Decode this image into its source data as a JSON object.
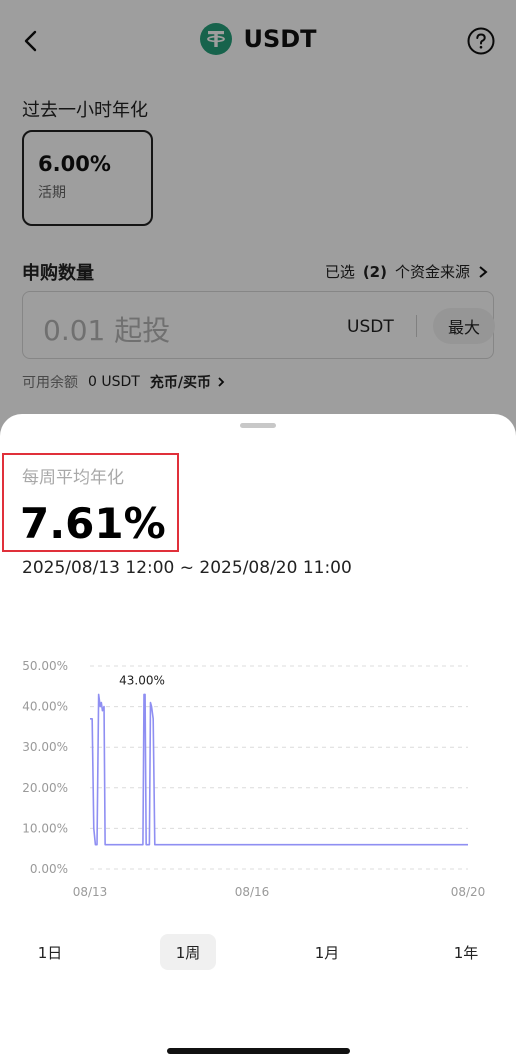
{
  "header": {
    "title": "USDT",
    "coin_icon": "tether-icon",
    "back_icon": "chevron-left-icon",
    "help_icon": "question-circle-icon"
  },
  "apr": {
    "label": "过去一小时年化",
    "value": "6.00%",
    "type": "活期"
  },
  "subscribe": {
    "label": "申购数量",
    "sources_prefix": "已选",
    "sources_count": "(2)",
    "sources_suffix": "个资金来源",
    "placeholder": "0.01 起投",
    "unit": "USDT",
    "max_label": "最大"
  },
  "balance": {
    "label": "可用余额",
    "amount": "0 USDT",
    "buy_label": "充币/买币"
  },
  "sheet": {
    "weekly_label": "每周平均年化",
    "weekly_value": "7.61%",
    "date_range": "2025/08/13 12:00 ~ 2025/08/20 11:00"
  },
  "chart_data": {
    "type": "line",
    "title": "",
    "xlabel": "",
    "ylabel": "",
    "ylim": [
      0,
      50
    ],
    "yticks": [
      "50.00%",
      "40.00%",
      "30.00%",
      "20.00%",
      "10.00%",
      "0.00%"
    ],
    "xticks": [
      "08/13",
      "08/16",
      "08/20"
    ],
    "xlim": [
      0,
      7
    ],
    "annotation": {
      "text": "43.00%",
      "x": 1.0,
      "y": 43
    },
    "grid": true,
    "color": "#8f8ff2",
    "series": [
      {
        "x": [
          0.0,
          0.04,
          0.07,
          0.1,
          0.13,
          0.16,
          0.19,
          0.21,
          0.23,
          0.26,
          0.28,
          0.3,
          0.55,
          0.98,
          1.0,
          1.02,
          1.04,
          1.07,
          1.1,
          1.12,
          1.14,
          1.17,
          1.2,
          1.24,
          7.0
        ],
        "y": [
          37,
          37,
          10,
          6,
          6,
          43,
          40,
          41,
          39,
          40,
          6,
          6,
          6,
          6,
          43,
          43,
          6,
          6,
          6,
          41,
          40,
          37,
          6,
          6,
          6
        ]
      }
    ]
  },
  "periods": [
    {
      "label": "1日",
      "active": false
    },
    {
      "label": "1周",
      "active": true
    },
    {
      "label": "1月",
      "active": false
    },
    {
      "label": "1年",
      "active": false
    }
  ]
}
